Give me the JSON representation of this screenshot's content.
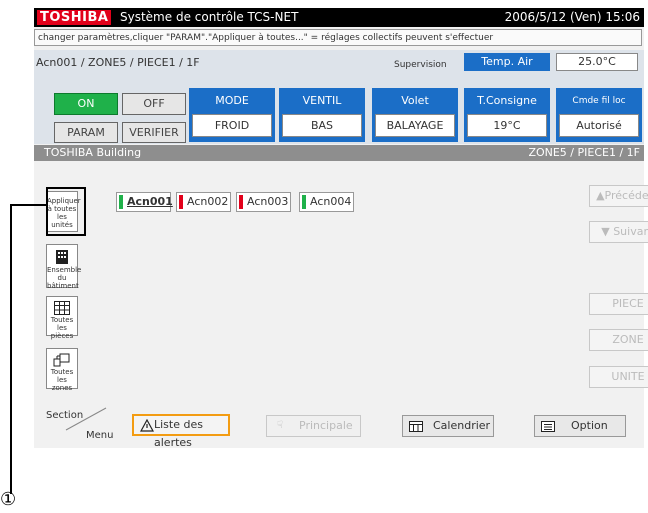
{
  "header": {
    "brand": "TOSHIBA",
    "title": "Système de contrôle TCS-NET",
    "datetime": "2006/5/12 (Ven)  15:06"
  },
  "info_message": "changer paramètres,cliquer \"PARAM\".\"Appliquer à toutes...\" = réglages collectifs peuvent s'effectuer",
  "unit_panel": {
    "path": "Acn001 / ZONE5 / PIECE1 / 1F",
    "supervision": "Supervision",
    "temp_air_label": "Temp. Air",
    "temp_air_value": "25.0°C",
    "on_label": "ON",
    "off_label": "OFF",
    "param_label": "PARAM",
    "verifier_label": "VERIFIER",
    "mode_label": "MODE",
    "mode_value": "FROID",
    "ventil_label": "VENTIL",
    "ventil_value": "BAS",
    "volet_label": "Volet",
    "volet_value": "BALAYAGE",
    "consigne_label": "T.Consigne",
    "consigne_value": "19°C",
    "cmde_label": "Cmde fil loc",
    "cmde_value": "Autorisé"
  },
  "location_bar": {
    "building": "TOSHIBA Building",
    "zone_path": "ZONE5 / PIECE1 / 1F"
  },
  "sidebar": {
    "apply_all": "Appliquer à toutes les unités",
    "building_all": "Ensemble du bâtiment",
    "all_rooms": "Toutes les pièces",
    "all_zones": "Toutes les zones"
  },
  "unit_tabs": [
    {
      "label": "Acn001",
      "color": "#1fb14a"
    },
    {
      "label": "Acn002",
      "color": "#e2001a"
    },
    {
      "label": "Acn003",
      "color": "#e2001a"
    },
    {
      "label": "Acn004",
      "color": "#1fb14a"
    }
  ],
  "nav": {
    "previous": "▲Précédent",
    "next": "▼ Suivant",
    "piece": "PIECE",
    "zone": "ZONE",
    "unite": "UNITE"
  },
  "bottom": {
    "section": "Section",
    "menu": "Menu",
    "alerts": "Liste des alertes",
    "principale": "Principale",
    "calendrier": "Calendrier",
    "option": "Option"
  },
  "callout": "①",
  "colors": {
    "on": "#1fb14a",
    "header_blue": "#1b6ec7",
    "brand_red": "#e2001a"
  }
}
